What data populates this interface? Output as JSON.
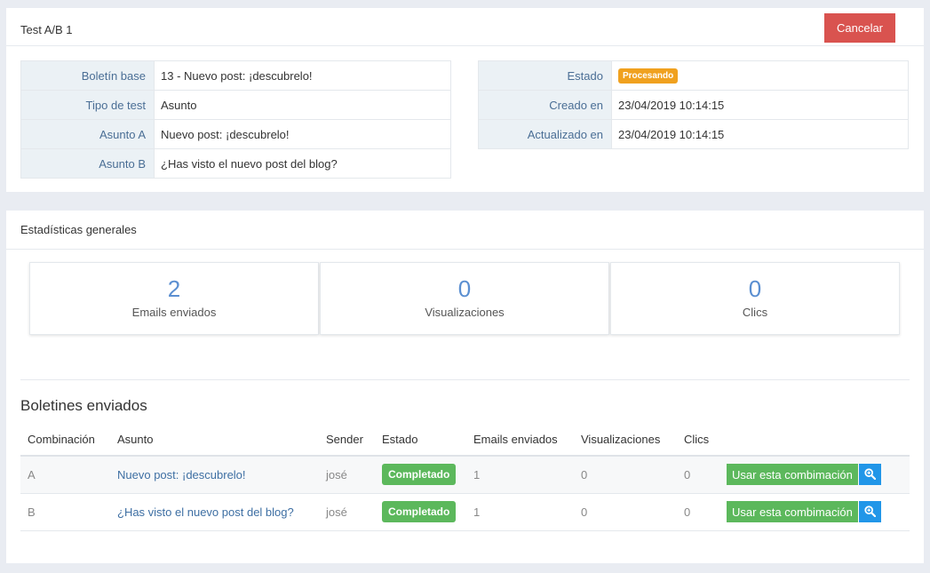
{
  "test_panel": {
    "title": "Test A/B 1",
    "cancel_label": "Cancelar",
    "left_rows": [
      {
        "key": "Boletín base",
        "value": "13 - Nuevo post: ¡descubrelo!"
      },
      {
        "key": "Tipo de test",
        "value": "Asunto"
      },
      {
        "key": "Asunto A",
        "value": "Nuevo post: ¡descubrelo!"
      },
      {
        "key": "Asunto B",
        "value": "¿Has visto el nuevo post del blog?"
      }
    ],
    "right_rows": [
      {
        "key": "Estado",
        "value": "Procesando"
      },
      {
        "key": "Creado en",
        "value": "23/04/2019 10:14:15"
      },
      {
        "key": "Actualizado en",
        "value": "23/04/2019 10:14:15"
      }
    ]
  },
  "stats_panel": {
    "title": "Estadísticas generales",
    "boxes": [
      {
        "value": "2",
        "label": "Emails enviados"
      },
      {
        "value": "0",
        "label": "Visualizaciones"
      },
      {
        "value": "0",
        "label": "Clics"
      }
    ]
  },
  "sent": {
    "title": "Boletines enviados",
    "headers": [
      "Combinación",
      "Asunto",
      "Sender",
      "Estado",
      "Emails enviados",
      "Visualizaciones",
      "Clics"
    ],
    "rows": [
      {
        "combination": "A",
        "subject": "Nuevo post: ¡descubrelo!",
        "sender": "josé",
        "status": "Completado",
        "emails": "1",
        "views": "0",
        "clicks": "0",
        "action_label": "Usar esta combimación"
      },
      {
        "combination": "B",
        "subject": "¿Has visto el nuevo post del blog?",
        "sender": "josé",
        "status": "Completado",
        "emails": "1",
        "views": "0",
        "clicks": "0",
        "action_label": "Usar esta combimación"
      }
    ],
    "zoom_icon": "zoom-in-icon"
  },
  "colors": {
    "cancel": "#d9534f",
    "processing_badge": "#f0a11f",
    "success": "#5cb85c",
    "zoom_button": "#2196e8",
    "stat_number": "#5b8fd1",
    "label_key": "#4a6e95"
  }
}
